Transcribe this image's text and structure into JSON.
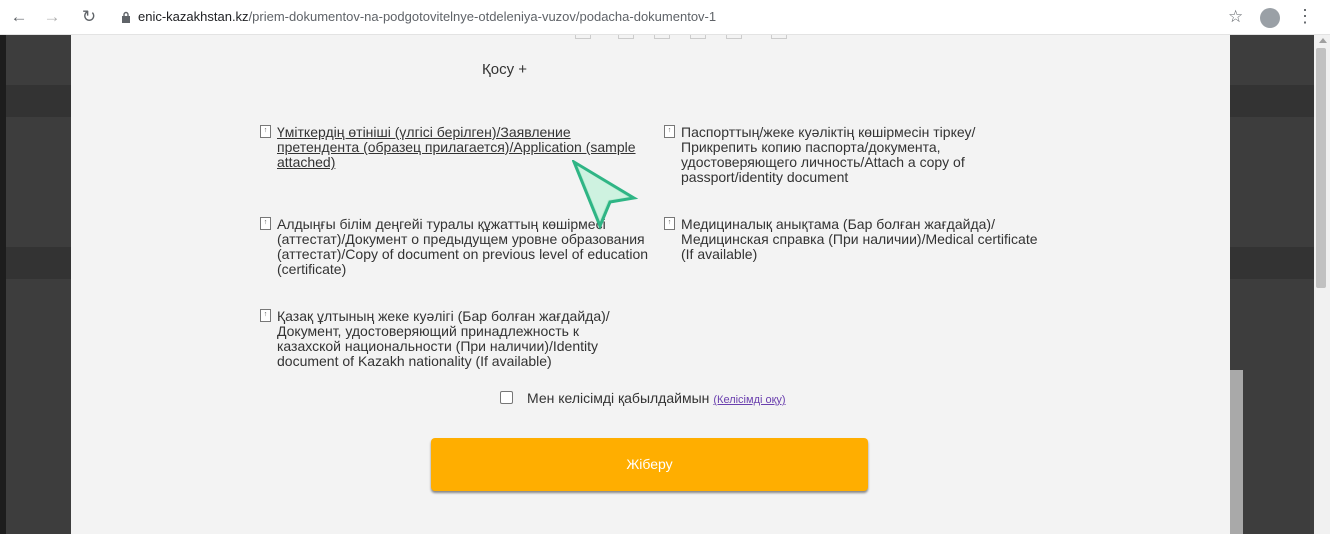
{
  "browser": {
    "url_domain": "enic-kazakhstan.kz",
    "url_path": "/priem-dokumentov-na-podgotovitelnye-otdeleniya-vuzov/podacha-dokumentov-1"
  },
  "form": {
    "add_label": "Қосу +",
    "items": [
      {
        "label": "Үміткердің өтініші (үлгісі берілген)/Заявление претендента (образец прилагается)/Application (sample attached)",
        "linked": true
      },
      {
        "label": "Паспорттың/жеке куәліктің көшірмесін тіркеу/ Прикрепить копию паспорта/документа, удостоверяющего личность/Attach a copy of passport/identity document",
        "linked": false
      },
      {
        "label": "Алдыңғы білім деңгейі туралы құжаттың көшірмесі (аттестат)/Документ о предыдущем уровне образования (аттестат)/Copy of document on previous level of education (certificate)",
        "linked": false
      },
      {
        "label": "Медициналық анықтама (Бар болған жағдайда)/ Медицинская справка (При наличии)/Medical certificate (If available)",
        "linked": false
      },
      {
        "label": "Қазақ ұлтының жеке куәлігі (Бар болған жағдайда)/Документ, удостоверяющий принадлежность к казахской национальности (При наличии)/Identity document of Kazakh nationality (If available)",
        "linked": false
      }
    ],
    "agreement_label": "Мен келісімді қабылдаймын",
    "agreement_link": "(Келісімді оқу)",
    "submit_label": "Жіберу"
  }
}
